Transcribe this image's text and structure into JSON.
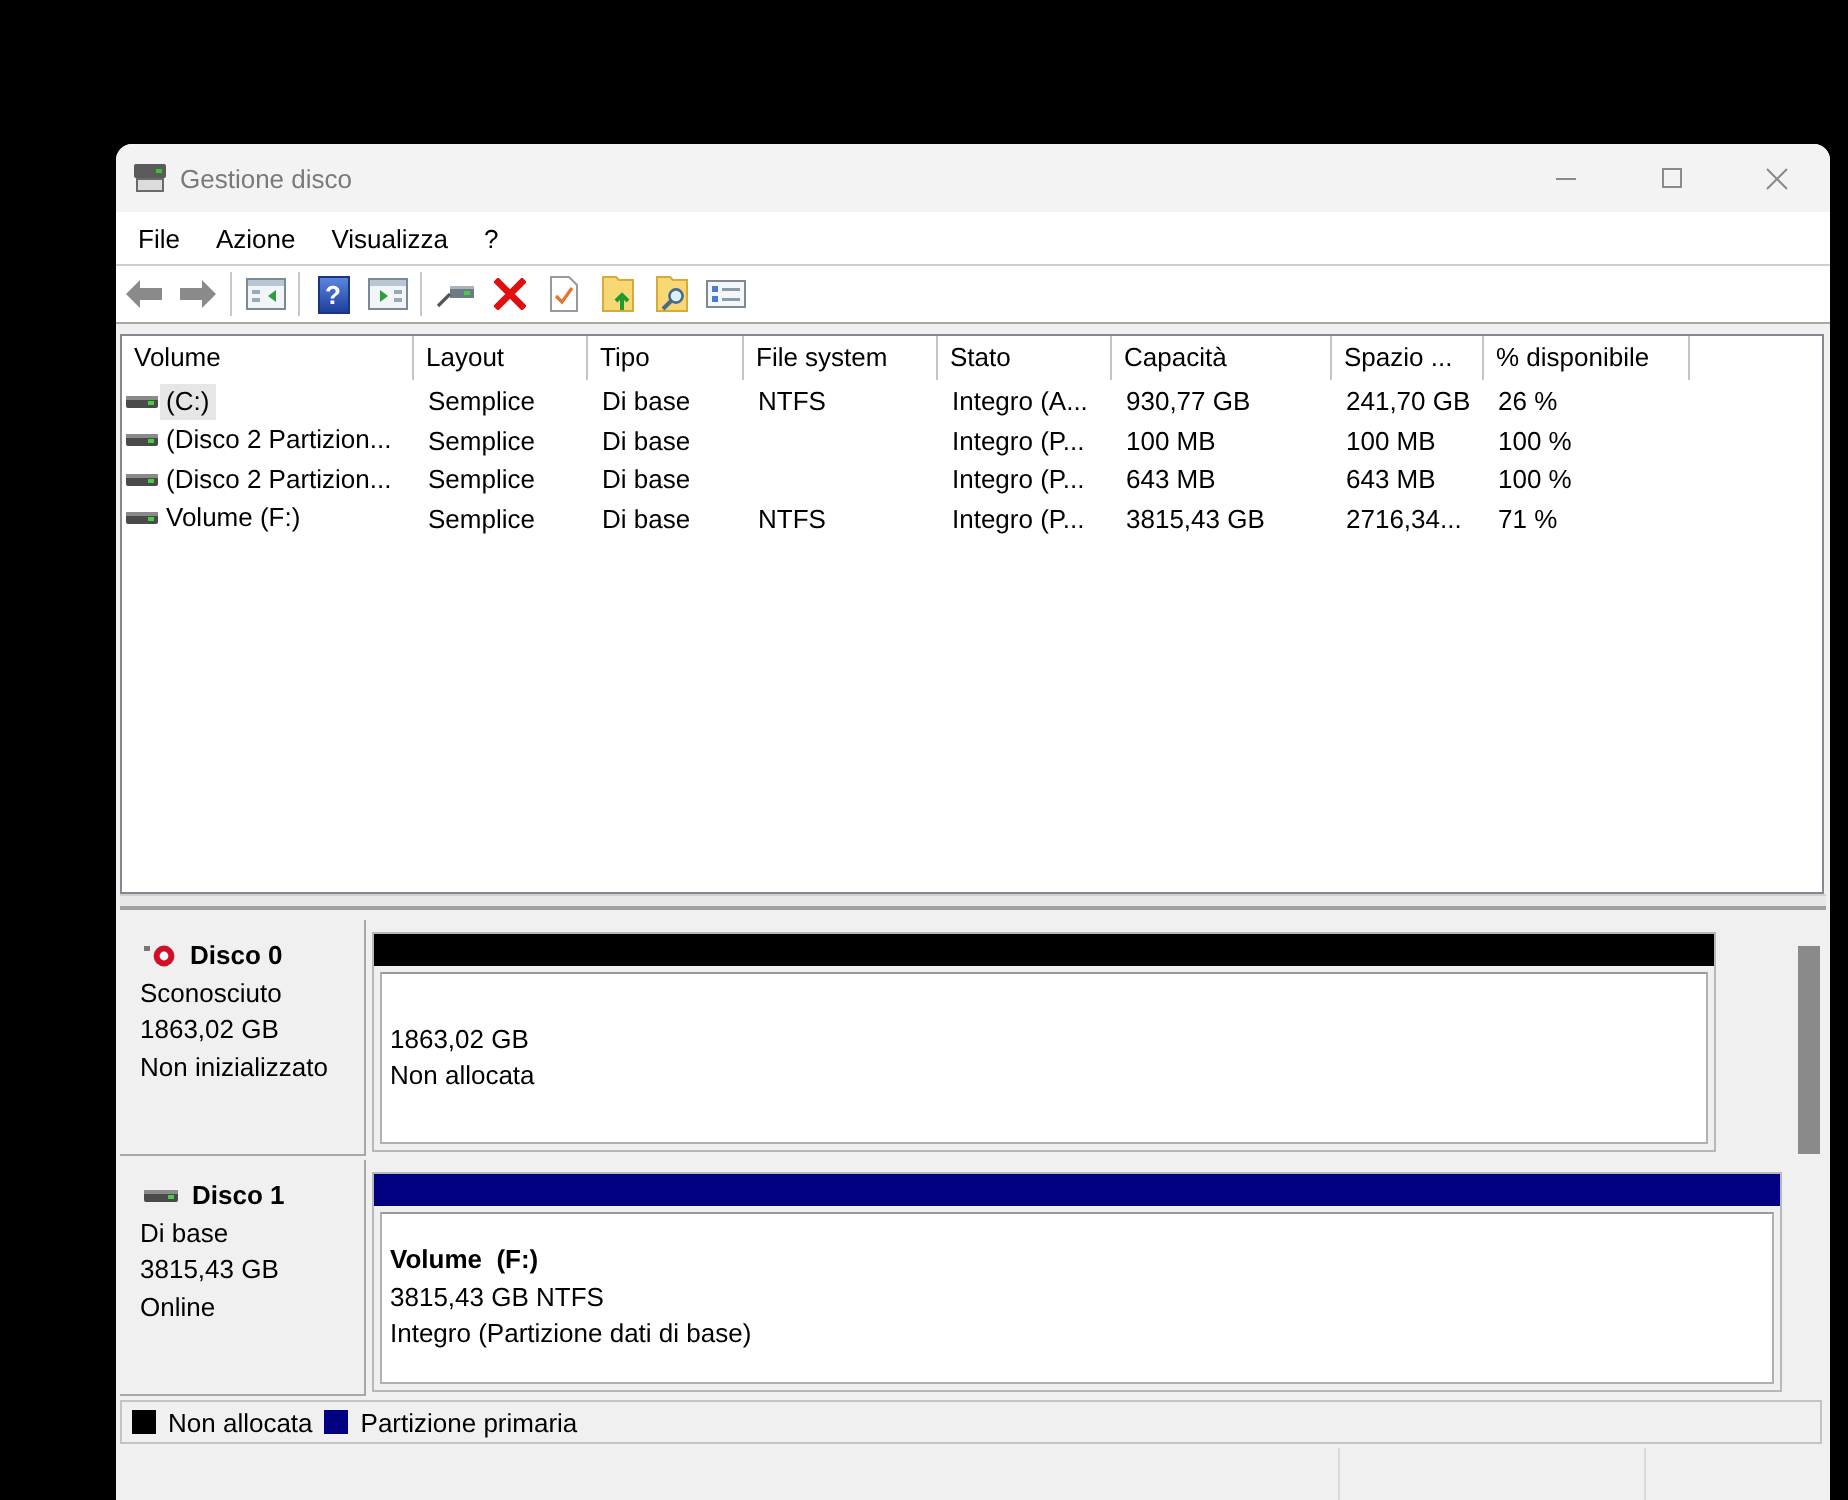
{
  "window": {
    "title": "Gestione disco"
  },
  "menu": [
    {
      "label": "File"
    },
    {
      "label": "Azione"
    },
    {
      "label": "Visualizza"
    },
    {
      "label": "?"
    }
  ],
  "toolbar": {
    "groups": [
      [
        {
          "kind": "arrow_left"
        },
        {
          "kind": "arrow_right"
        }
      ],
      [
        {
          "kind": "window_arrow_left"
        }
      ],
      [
        {
          "kind": "help",
          "glyph": "?"
        },
        {
          "kind": "window_arrow_right"
        }
      ],
      [
        {
          "kind": "drive_cable"
        },
        {
          "kind": "red_x"
        },
        {
          "kind": "document_check"
        },
        {
          "kind": "folder_arrow"
        },
        {
          "kind": "folder_magnifier"
        },
        {
          "kind": "checklist"
        }
      ]
    ]
  },
  "table": {
    "columns": [
      {
        "label": "Volume"
      },
      {
        "label": "Layout"
      },
      {
        "label": "Tipo"
      },
      {
        "label": "File system"
      },
      {
        "label": "Stato"
      },
      {
        "label": "Capacità"
      },
      {
        "label": "Spazio ..."
      },
      {
        "label": "% disponibile"
      }
    ],
    "rows": [
      {
        "volume": "(C:)",
        "layout": "Semplice",
        "type": "Di base",
        "file_system": "NTFS",
        "status": "Integro (A...",
        "capacity": "930,77 GB",
        "free_space": "241,70 GB",
        "percent_free": "26 %",
        "selected": true
      },
      {
        "volume": "(Disco 2 Partizion...",
        "layout": "Semplice",
        "type": "Di base",
        "status": "Integro (P...",
        "capacity": "100 MB",
        "free_space": "100 MB",
        "percent_free": "100 %",
        "selected": false
      },
      {
        "volume": "(Disco 2 Partizion...",
        "layout": "Semplice",
        "type": "Di base",
        "status": "Integro (P...",
        "capacity": "643 MB",
        "free_space": "643 MB",
        "percent_free": "100 %",
        "selected": false
      },
      {
        "volume": "Volume (F:)",
        "layout": "Semplice",
        "type": "Di base",
        "file_system": "NTFS",
        "status": "Integro (P...",
        "capacity": "3815,43 GB",
        "free_space": "2716,34...",
        "percent_free": "71 %",
        "selected": false
      }
    ]
  },
  "disks": [
    {
      "name": "Disco 0",
      "initialized": false,
      "details": [
        "Sconosciuto",
        "1863,02 GB",
        "Non inizializzato"
      ],
      "partitions": [
        {
          "color": "#000000",
          "lines": [
            "1863,02 GB",
            "Non allocata"
          ]
        }
      ]
    },
    {
      "name": "Disco 1",
      "initialized": true,
      "details": [
        "Di base",
        "3815,43 GB",
        "Online"
      ],
      "partitions": [
        {
          "color": "#000080",
          "title": "Volume  (F:)",
          "lines": [
            "3815,43 GB NTFS",
            "Integro (Partizione dati di base)"
          ]
        }
      ]
    }
  ],
  "legend": [
    {
      "label": "Non allocata",
      "color": "#000000"
    },
    {
      "label": "Partizione primaria",
      "color": "#000080"
    }
  ]
}
